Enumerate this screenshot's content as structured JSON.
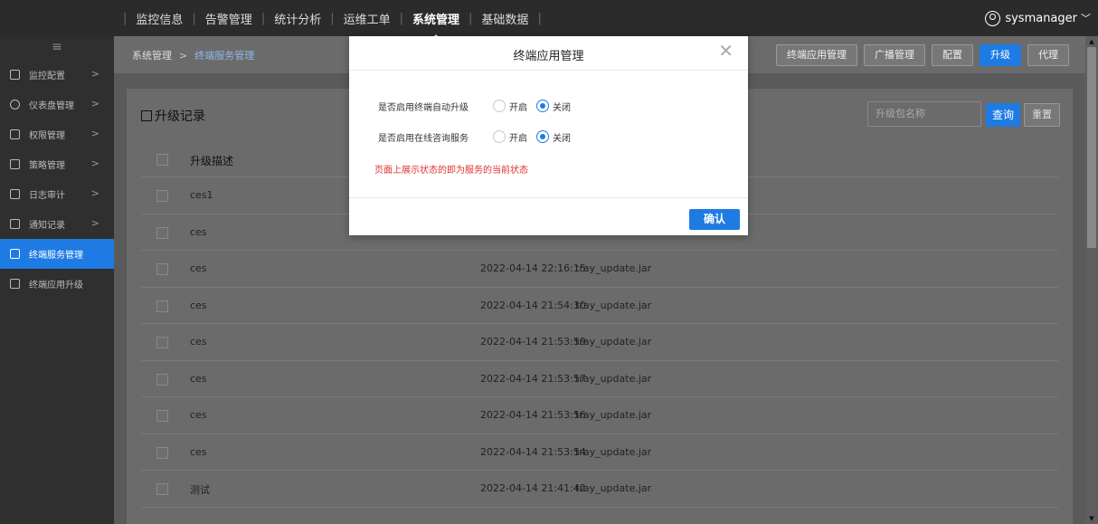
{
  "topnav": {
    "items": [
      "监控信息",
      "告警管理",
      "统计分析",
      "运维工单",
      "系统管理",
      "基础数据"
    ],
    "active_index": 4,
    "user": "sysmanager"
  },
  "sidebar": {
    "items": [
      {
        "label": "监控配置",
        "has_arrow": true
      },
      {
        "label": "仪表盘管理",
        "has_arrow": true
      },
      {
        "label": "权限管理",
        "has_arrow": true
      },
      {
        "label": "策略管理",
        "has_arrow": true
      },
      {
        "label": "日志审计",
        "has_arrow": true
      },
      {
        "label": "通知记录",
        "has_arrow": true
      },
      {
        "label": "终端服务管理",
        "has_arrow": false,
        "active": true
      },
      {
        "label": "终端应用升级",
        "has_arrow": false
      }
    ]
  },
  "breadcrumb": {
    "root": "系统管理",
    "current": "终端服务管理"
  },
  "tabs": [
    "终端应用管理",
    "广播管理",
    "配置",
    "升级",
    "代理"
  ],
  "active_tab": "升级",
  "panel": {
    "title": "升级记录",
    "search_placeholder": "升级包名称",
    "query_label": "查询",
    "reset_label": "重置",
    "column_desc": "升级描述",
    "rows": [
      {
        "desc": "ces1",
        "time": "",
        "file": ""
      },
      {
        "desc": "ces",
        "time": "",
        "file": ""
      },
      {
        "desc": "ces",
        "time": "2022-04-14 22:16:15",
        "file": "tray_update.jar"
      },
      {
        "desc": "ces",
        "time": "2022-04-14 21:54:30",
        "file": "tray_update.jar"
      },
      {
        "desc": "ces",
        "time": "2022-04-14 21:53:59",
        "file": "tray_update.jar"
      },
      {
        "desc": "ces",
        "time": "2022-04-14 21:53:57",
        "file": "tray_update.jar"
      },
      {
        "desc": "ces",
        "time": "2022-04-14 21:53:56",
        "file": "tray_update.jar"
      },
      {
        "desc": "ces",
        "time": "2022-04-14 21:53:54",
        "file": "tray_update.jar"
      },
      {
        "desc": "测试",
        "time": "2022-04-14 21:41:42",
        "file": "tray_update.jar"
      }
    ]
  },
  "modal": {
    "title": "终端应用管理",
    "options": [
      {
        "label": "是否启用终端自动升级",
        "on_label": "开启",
        "off_label": "关闭",
        "selected": "off"
      },
      {
        "label": "是否启用在线咨询服务",
        "on_label": "开启",
        "off_label": "关闭",
        "selected": "off"
      }
    ],
    "note": "页面上展示状态的即为服务的当前状态",
    "confirm_label": "确认"
  },
  "colors": {
    "accent": "#1e7be3",
    "note": "#e03030"
  }
}
